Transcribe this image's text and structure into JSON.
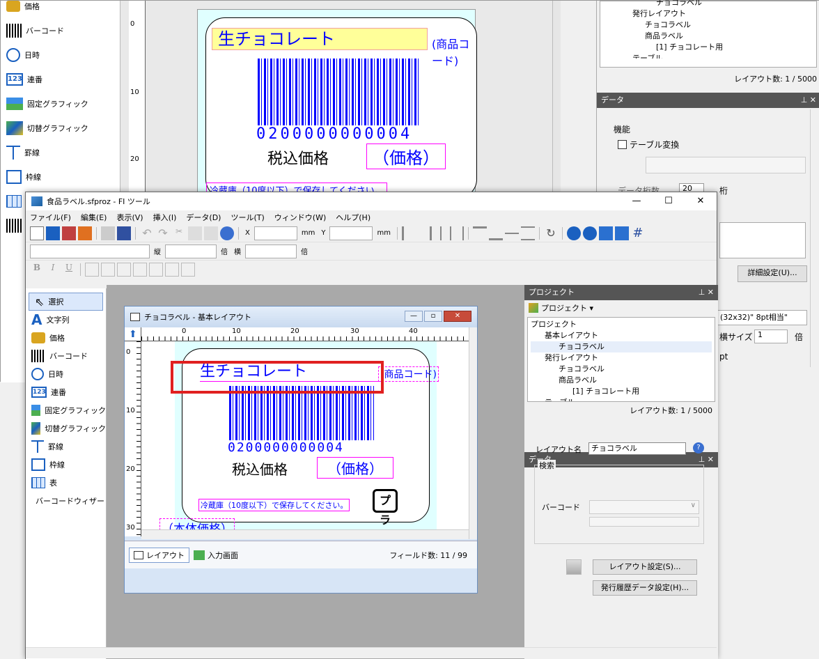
{
  "bg": {
    "tools": [
      "価格",
      "バーコード",
      "日時",
      "連番",
      "固定グラフィック",
      "切替グラフィック",
      "罫線",
      "枠線",
      "表"
    ],
    "tree": [
      "チョコラベル",
      "発行レイアウト",
      "チョコラベル",
      "商品ラベル",
      "[1] チョコレート用",
      "テーブル"
    ],
    "layout_count": "レイアウト数: 1 / 5000",
    "data_title": "データ",
    "kinou_label": "機能",
    "table_convert": "テーブル変換",
    "digits_label": "データ桁数",
    "digits_value": "20",
    "digits_unit": "桁",
    "detail_btn": "詳細設定(U)...",
    "font_select": "(32x32)\" 8pt相当\"",
    "yoko_label": "横サイズ",
    "yoko_value": "1",
    "bai": "倍",
    "pt": "pt",
    "canvas": {
      "title": "生チョコレート",
      "code": "(商品コード)",
      "barcode_digits": "0200000000004",
      "price_label": "税込価格",
      "price_field": "（価格）",
      "note": "冷蔵庫（10度以下）で保存してください。",
      "ruler_marks": [
        "0",
        "10",
        "20"
      ]
    }
  },
  "app": {
    "title": "食品ラベル.sfproz - FI ツール",
    "menu": [
      "ファイル(F)",
      "編集(E)",
      "表示(V)",
      "挿入(I)",
      "データ(D)",
      "ツール(T)",
      "ウィンドウ(W)",
      "ヘルプ(H)"
    ],
    "x_label": "X",
    "y_label": "Y",
    "mm": "mm",
    "tate": "縦",
    "bai": "倍",
    "yoko": "横",
    "tools": [
      "選択",
      "文字列",
      "価格",
      "バーコード",
      "日時",
      "連番",
      "固定グラフィック",
      "切替グラフィック",
      "罫線",
      "枠線",
      "表",
      "バーコードウィザード"
    ]
  },
  "doc": {
    "title": "チョコラベル - 基本レイアウト",
    "ruler_h": [
      "0",
      "10",
      "20",
      "30",
      "40"
    ],
    "ruler_v": [
      "0",
      "10",
      "20",
      "30"
    ],
    "label": {
      "title": "生チョコレート",
      "code": "(商品コード)",
      "barcode_digits": "0200000000004",
      "price_label": "税込価格",
      "price_field": "（価格）",
      "note": "冷蔵庫（10度以下）で保存してください。",
      "honntai": "（本体価格）"
    },
    "tab_layout": "レイアウト",
    "tab_input": "入力画面",
    "field_count": "フィールド数: 11 / 99"
  },
  "project": {
    "title": "プロジェクト",
    "dropdown": "プロジェクト ▾",
    "tree": [
      "プロジェクト",
      "基本レイアウト",
      "チョコラベル",
      "発行レイアウト",
      "チョコラベル",
      "商品ラベル",
      "[1] チョコレート用",
      "テーブル"
    ],
    "layout_count": "レイアウト数: 1 / 5000"
  },
  "data_panel": {
    "title": "データ",
    "layout_name_label": "レイアウト名",
    "layout_name_value": "チョコラベル",
    "search_group": "検索",
    "barcode_label": "バーコード",
    "layout_settings_btn": "レイアウト設定(S)...",
    "history_btn": "発行履歴データ設定(H)..."
  },
  "colors": {
    "highlight": "#ff0000",
    "field_text": "#0000ff",
    "field_border": "#ff00ff"
  }
}
